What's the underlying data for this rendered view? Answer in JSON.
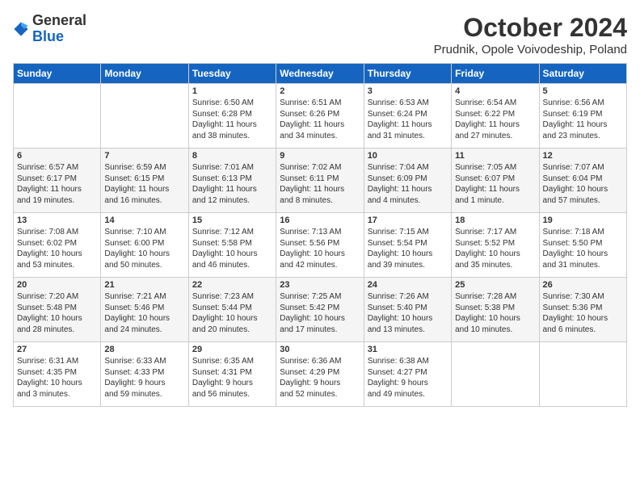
{
  "header": {
    "logo": {
      "line1": "General",
      "line2": "Blue"
    },
    "title": "October 2024",
    "subtitle": "Prudnik, Opole Voivodeship, Poland"
  },
  "weekdays": [
    "Sunday",
    "Monday",
    "Tuesday",
    "Wednesday",
    "Thursday",
    "Friday",
    "Saturday"
  ],
  "weeks": [
    [
      {
        "day": "",
        "info": ""
      },
      {
        "day": "",
        "info": ""
      },
      {
        "day": "1",
        "info": "Sunrise: 6:50 AM\nSunset: 6:28 PM\nDaylight: 11 hours\nand 38 minutes."
      },
      {
        "day": "2",
        "info": "Sunrise: 6:51 AM\nSunset: 6:26 PM\nDaylight: 11 hours\nand 34 minutes."
      },
      {
        "day": "3",
        "info": "Sunrise: 6:53 AM\nSunset: 6:24 PM\nDaylight: 11 hours\nand 31 minutes."
      },
      {
        "day": "4",
        "info": "Sunrise: 6:54 AM\nSunset: 6:22 PM\nDaylight: 11 hours\nand 27 minutes."
      },
      {
        "day": "5",
        "info": "Sunrise: 6:56 AM\nSunset: 6:19 PM\nDaylight: 11 hours\nand 23 minutes."
      }
    ],
    [
      {
        "day": "6",
        "info": "Sunrise: 6:57 AM\nSunset: 6:17 PM\nDaylight: 11 hours\nand 19 minutes."
      },
      {
        "day": "7",
        "info": "Sunrise: 6:59 AM\nSunset: 6:15 PM\nDaylight: 11 hours\nand 16 minutes."
      },
      {
        "day": "8",
        "info": "Sunrise: 7:01 AM\nSunset: 6:13 PM\nDaylight: 11 hours\nand 12 minutes."
      },
      {
        "day": "9",
        "info": "Sunrise: 7:02 AM\nSunset: 6:11 PM\nDaylight: 11 hours\nand 8 minutes."
      },
      {
        "day": "10",
        "info": "Sunrise: 7:04 AM\nSunset: 6:09 PM\nDaylight: 11 hours\nand 4 minutes."
      },
      {
        "day": "11",
        "info": "Sunrise: 7:05 AM\nSunset: 6:07 PM\nDaylight: 11 hours\nand 1 minute."
      },
      {
        "day": "12",
        "info": "Sunrise: 7:07 AM\nSunset: 6:04 PM\nDaylight: 10 hours\nand 57 minutes."
      }
    ],
    [
      {
        "day": "13",
        "info": "Sunrise: 7:08 AM\nSunset: 6:02 PM\nDaylight: 10 hours\nand 53 minutes."
      },
      {
        "day": "14",
        "info": "Sunrise: 7:10 AM\nSunset: 6:00 PM\nDaylight: 10 hours\nand 50 minutes."
      },
      {
        "day": "15",
        "info": "Sunrise: 7:12 AM\nSunset: 5:58 PM\nDaylight: 10 hours\nand 46 minutes."
      },
      {
        "day": "16",
        "info": "Sunrise: 7:13 AM\nSunset: 5:56 PM\nDaylight: 10 hours\nand 42 minutes."
      },
      {
        "day": "17",
        "info": "Sunrise: 7:15 AM\nSunset: 5:54 PM\nDaylight: 10 hours\nand 39 minutes."
      },
      {
        "day": "18",
        "info": "Sunrise: 7:17 AM\nSunset: 5:52 PM\nDaylight: 10 hours\nand 35 minutes."
      },
      {
        "day": "19",
        "info": "Sunrise: 7:18 AM\nSunset: 5:50 PM\nDaylight: 10 hours\nand 31 minutes."
      }
    ],
    [
      {
        "day": "20",
        "info": "Sunrise: 7:20 AM\nSunset: 5:48 PM\nDaylight: 10 hours\nand 28 minutes."
      },
      {
        "day": "21",
        "info": "Sunrise: 7:21 AM\nSunset: 5:46 PM\nDaylight: 10 hours\nand 24 minutes."
      },
      {
        "day": "22",
        "info": "Sunrise: 7:23 AM\nSunset: 5:44 PM\nDaylight: 10 hours\nand 20 minutes."
      },
      {
        "day": "23",
        "info": "Sunrise: 7:25 AM\nSunset: 5:42 PM\nDaylight: 10 hours\nand 17 minutes."
      },
      {
        "day": "24",
        "info": "Sunrise: 7:26 AM\nSunset: 5:40 PM\nDaylight: 10 hours\nand 13 minutes."
      },
      {
        "day": "25",
        "info": "Sunrise: 7:28 AM\nSunset: 5:38 PM\nDaylight: 10 hours\nand 10 minutes."
      },
      {
        "day": "26",
        "info": "Sunrise: 7:30 AM\nSunset: 5:36 PM\nDaylight: 10 hours\nand 6 minutes."
      }
    ],
    [
      {
        "day": "27",
        "info": "Sunrise: 6:31 AM\nSunset: 4:35 PM\nDaylight: 10 hours\nand 3 minutes."
      },
      {
        "day": "28",
        "info": "Sunrise: 6:33 AM\nSunset: 4:33 PM\nDaylight: 9 hours\nand 59 minutes."
      },
      {
        "day": "29",
        "info": "Sunrise: 6:35 AM\nSunset: 4:31 PM\nDaylight: 9 hours\nand 56 minutes."
      },
      {
        "day": "30",
        "info": "Sunrise: 6:36 AM\nSunset: 4:29 PM\nDaylight: 9 hours\nand 52 minutes."
      },
      {
        "day": "31",
        "info": "Sunrise: 6:38 AM\nSunset: 4:27 PM\nDaylight: 9 hours\nand 49 minutes."
      },
      {
        "day": "",
        "info": ""
      },
      {
        "day": "",
        "info": ""
      }
    ]
  ]
}
